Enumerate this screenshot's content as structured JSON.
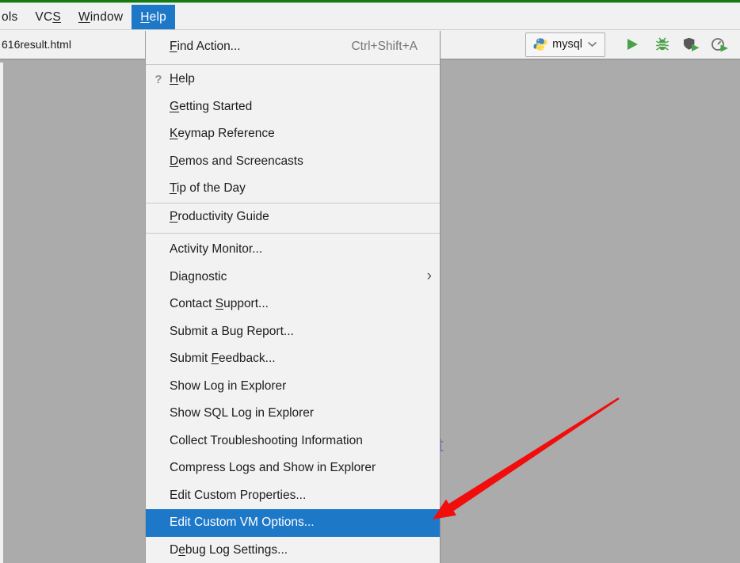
{
  "menubar": {
    "items": [
      {
        "label": "ols"
      },
      {
        "label": "VCS",
        "mnemonic": 2
      },
      {
        "label": "Window",
        "mnemonic": 0
      },
      {
        "label": "Help",
        "mnemonic": 0,
        "active": true
      }
    ]
  },
  "tab_bar": {
    "active_tab": "616result.html"
  },
  "toolbar": {
    "run_config_label": "mysql",
    "run_config_icon": "python-icon",
    "buttons": [
      {
        "name": "run-button",
        "icon": "play-icon"
      },
      {
        "name": "debug-button",
        "icon": "bug-icon"
      },
      {
        "name": "run-with-coverage-button",
        "icon": "shield-play-icon"
      },
      {
        "name": "profile-button",
        "icon": "stopwatch-play-icon"
      }
    ]
  },
  "help_menu": {
    "items": [
      {
        "label": "Find Action...",
        "mnemonic": 0,
        "shortcut": "Ctrl+Shift+A",
        "tall": true
      },
      {
        "separator": "s1"
      },
      {
        "label": "Help",
        "mnemonic": 0,
        "icon": "question-icon"
      },
      {
        "label": "Getting Started",
        "mnemonic": 0
      },
      {
        "label": "Keymap Reference",
        "mnemonic": 0
      },
      {
        "label": "Demos and Screencasts",
        "mnemonic": 0
      },
      {
        "label": "Tip of the Day",
        "mnemonic": 0
      },
      {
        "separator": "s2"
      },
      {
        "label": "Productivity Guide",
        "mnemonic": 0
      },
      {
        "separator": "s3"
      },
      {
        "label": "Activity Monitor..."
      },
      {
        "label": "Diagnostic",
        "submenu": true
      },
      {
        "label": "Contact Support...",
        "mnemonic": 8
      },
      {
        "label": "Submit a Bug Report..."
      },
      {
        "label": "Submit Feedback...",
        "mnemonic": 7
      },
      {
        "label": "Show Log in Explorer"
      },
      {
        "label": "Show SQL Log in Explorer"
      },
      {
        "label": "Collect Troubleshooting Information"
      },
      {
        "label": "Compress Logs and Show in Explorer"
      },
      {
        "label": "Edit Custom Properties..."
      },
      {
        "label": "Edit Custom VM Options...",
        "selected": true
      },
      {
        "label": "Debug Log Settings...",
        "mnemonic": 1
      }
    ]
  },
  "editor": {
    "background_text_fragment": "t"
  },
  "annotation": {
    "type": "arrow",
    "color": "#f20d0d"
  },
  "colors": {
    "accent_blue": "#1e78c8",
    "menu_bg": "#f2f2f2",
    "editor_bg": "#ababab",
    "top_bar_green": "#147a14",
    "icon_green": "#4aa14a",
    "arrow_red": "#f20d0d"
  }
}
